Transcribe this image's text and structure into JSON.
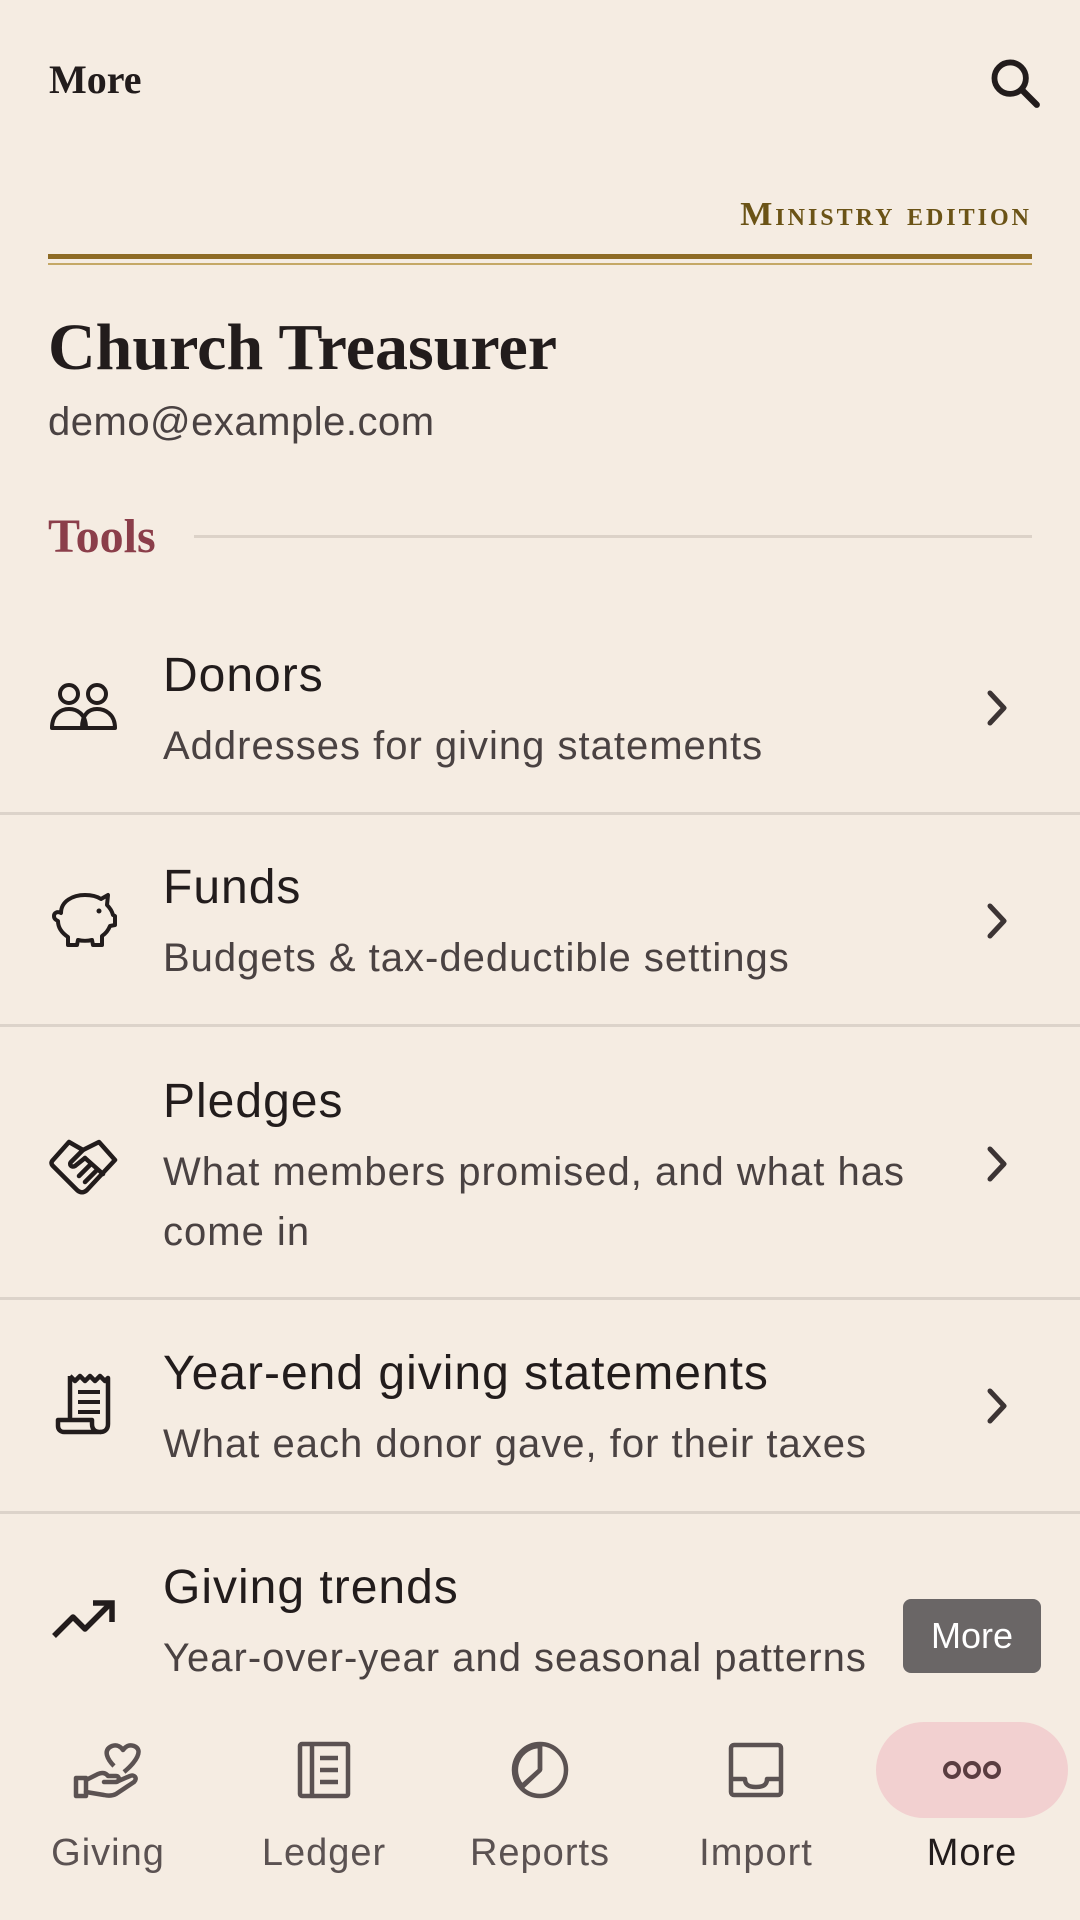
{
  "topbar": {
    "title": "More"
  },
  "header": {
    "edition": "Ministry edition",
    "org_name": "Church Treasurer",
    "email": "demo@example.com"
  },
  "section": {
    "title": "Tools"
  },
  "tools": [
    {
      "icon": "people-icon",
      "title": "Donors",
      "subtitle": "Addresses for giving statements"
    },
    {
      "icon": "piggy-bank-icon",
      "title": "Funds",
      "subtitle": "Budgets & tax-deductible settings"
    },
    {
      "icon": "handshake-icon",
      "title": "Pledges",
      "subtitle": "What members promised, and what has come in"
    },
    {
      "icon": "receipt-icon",
      "title": "Year-end giving statements",
      "subtitle": "What each donor gave, for their taxes"
    },
    {
      "icon": "trending-up-icon",
      "title": "Giving trends",
      "subtitle": "Year-over-year and seasonal patterns"
    }
  ],
  "tooltip": {
    "text": "More"
  },
  "nav": [
    {
      "icon": "heart-hand-icon",
      "label": "Giving",
      "active": false
    },
    {
      "icon": "ledger-icon",
      "label": "Ledger",
      "active": false
    },
    {
      "icon": "pie-chart-icon",
      "label": "Reports",
      "active": false
    },
    {
      "icon": "inbox-icon",
      "label": "Import",
      "active": false
    },
    {
      "icon": "more-dots-icon",
      "label": "More",
      "active": true
    }
  ],
  "colors": {
    "background": "#f5ece2",
    "accent_gold": "#8e6b25",
    "section_title": "#8b3e4a",
    "active_nav": "#f2d0d0"
  }
}
